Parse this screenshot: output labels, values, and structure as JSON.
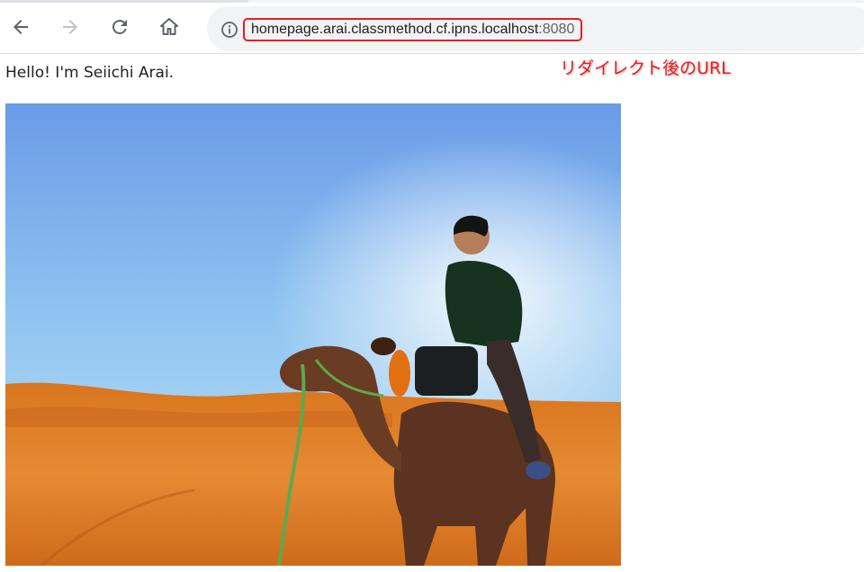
{
  "browser": {
    "nav": {
      "back_icon": "arrow-left-icon",
      "forward_icon": "arrow-right-icon",
      "reload_icon": "reload-icon",
      "home_icon": "home-icon"
    },
    "omnibox": {
      "info_icon": "info-icon",
      "url_host": "homepage.arai.classmethod.cf.ipns.localhost",
      "url_port": ":8080"
    },
    "annotation": "リダイレクト後のURL",
    "colors": {
      "annotation": "#ef1c1c",
      "highlight_border": "#e32020",
      "omnibox_bg": "#f1f3f4"
    }
  },
  "page": {
    "greeting": "Hello! I'm Seiichi Arai.",
    "photo": "photo of a man riding a camel in desert dunes"
  }
}
